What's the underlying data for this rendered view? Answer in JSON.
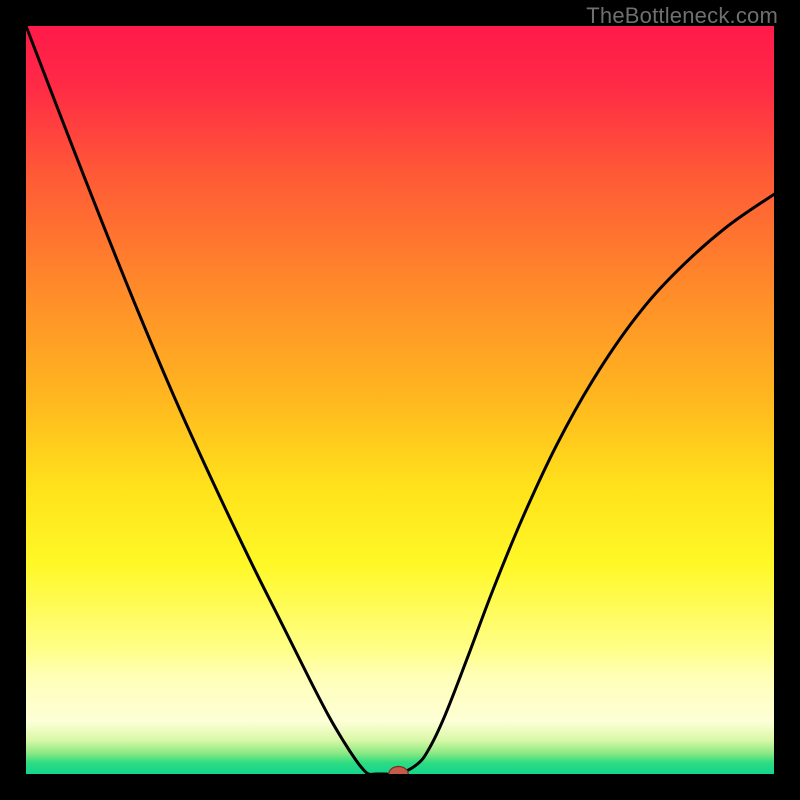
{
  "watermark": "TheBottleneck.com",
  "colors": {
    "frame_bg": "#000000",
    "watermark_text": "#6f6f6f",
    "curve_stroke": "#000000",
    "marker_fill": "#c55a4a",
    "marker_stroke": "#7a2e22",
    "gradient_stops": [
      {
        "offset": 0.0,
        "color": "#ff1a4a"
      },
      {
        "offset": 0.08,
        "color": "#ff2a46"
      },
      {
        "offset": 0.2,
        "color": "#ff5a36"
      },
      {
        "offset": 0.35,
        "color": "#ff8a2a"
      },
      {
        "offset": 0.5,
        "color": "#ffb81f"
      },
      {
        "offset": 0.62,
        "color": "#ffe31b"
      },
      {
        "offset": 0.72,
        "color": "#fff827"
      },
      {
        "offset": 0.835,
        "color": "#ffff8a"
      },
      {
        "offset": 0.87,
        "color": "#ffffb8"
      },
      {
        "offset": 0.93,
        "color": "#fdffd6"
      },
      {
        "offset": 0.955,
        "color": "#d8f8a6"
      },
      {
        "offset": 0.972,
        "color": "#8ce983"
      },
      {
        "offset": 0.985,
        "color": "#2edc82"
      },
      {
        "offset": 1.0,
        "color": "#12d58e"
      }
    ]
  },
  "chart_data": {
    "type": "line",
    "title": "",
    "xlabel": "",
    "ylabel": "",
    "xlim": [
      0,
      1
    ],
    "ylim": [
      0,
      1
    ],
    "grid": false,
    "legend": false,
    "series": [
      {
        "name": "bottleneck-curve",
        "x": [
          0.0,
          0.05,
          0.1,
          0.15,
          0.2,
          0.25,
          0.3,
          0.34,
          0.38,
          0.405,
          0.425,
          0.44,
          0.45,
          0.458,
          0.468,
          0.48,
          0.498,
          0.523,
          0.539,
          0.56,
          0.59,
          0.625,
          0.665,
          0.71,
          0.76,
          0.815,
          0.87,
          0.935,
          1.0
        ],
        "y": [
          1.0,
          0.87,
          0.742,
          0.618,
          0.5,
          0.39,
          0.285,
          0.205,
          0.125,
          0.077,
          0.043,
          0.02,
          0.007,
          0.0,
          0.0,
          0.0,
          0.0,
          0.013,
          0.034,
          0.078,
          0.155,
          0.248,
          0.345,
          0.441,
          0.53,
          0.61,
          0.672,
          0.73,
          0.775
        ]
      }
    ],
    "marker": {
      "x": 0.498,
      "y": 0.0,
      "rx": 0.013,
      "ry": 0.01
    },
    "background_meaning": "vertical gradient from red (high bottleneck) at top through orange/yellow to green (low bottleneck) at bottom"
  }
}
